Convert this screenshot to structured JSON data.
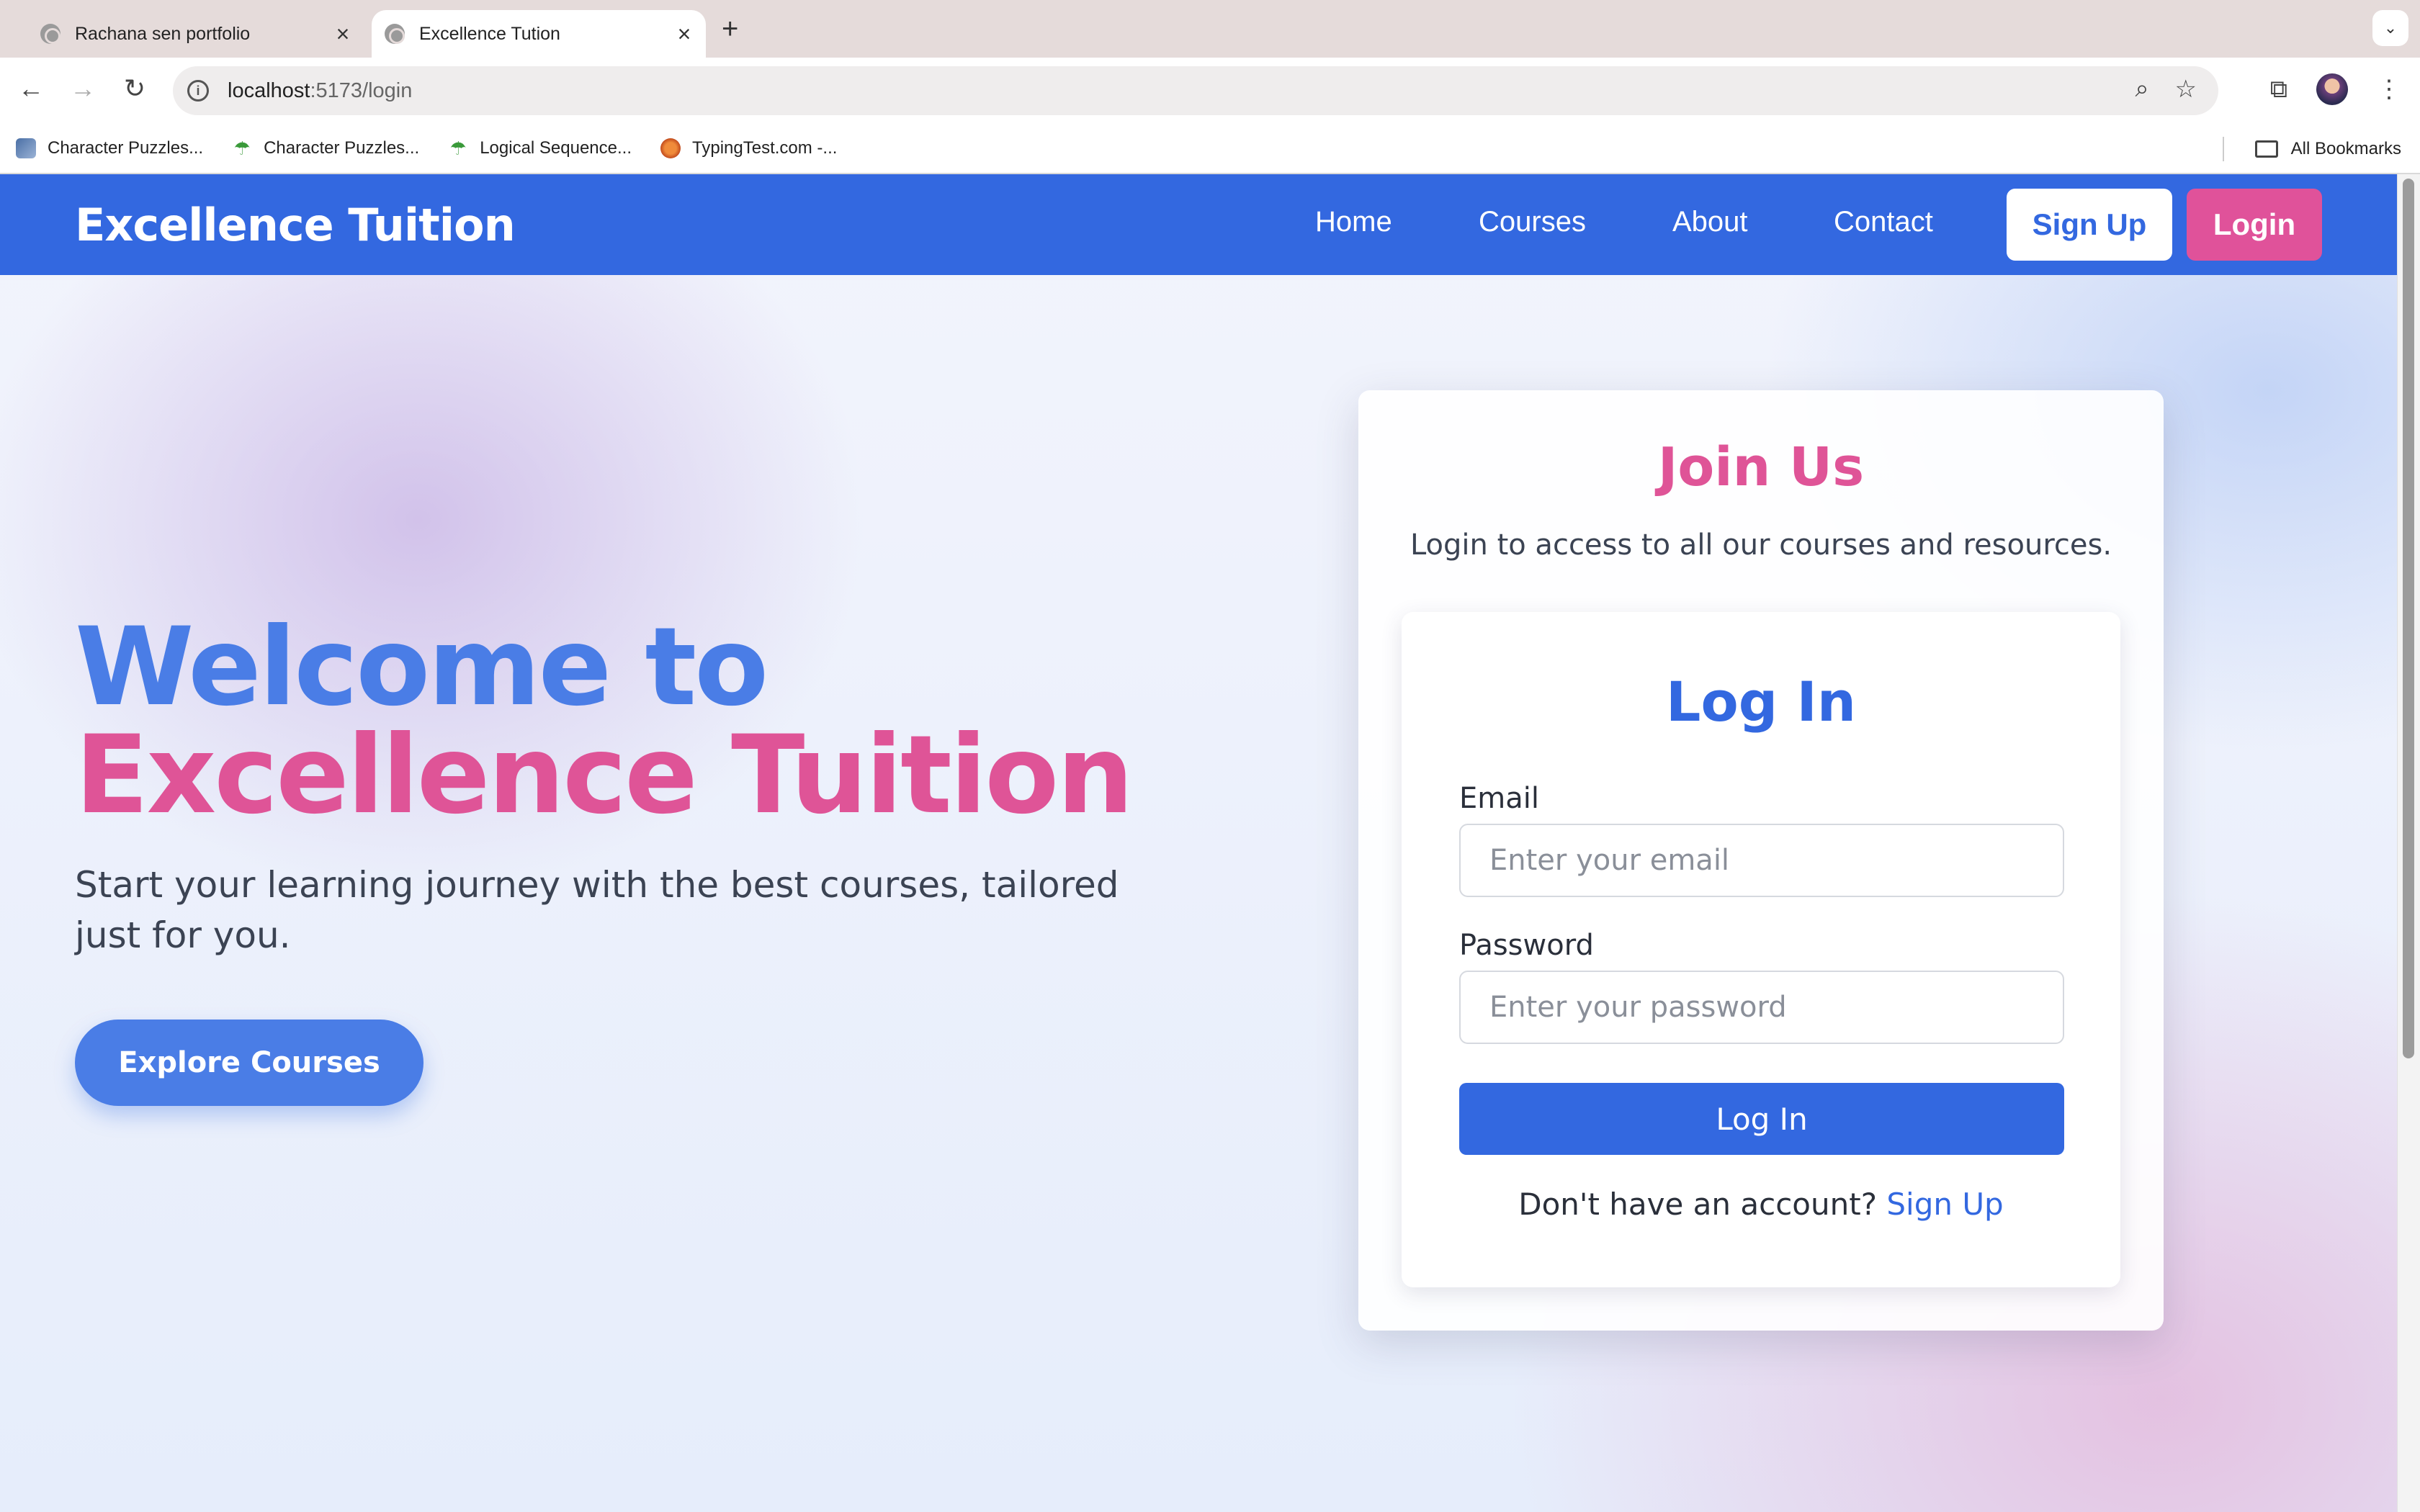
{
  "browser": {
    "tabs": [
      {
        "title": "Rachana sen portfolio",
        "active": false
      },
      {
        "title": "Excellence Tution",
        "active": true
      }
    ],
    "new_tab": "+",
    "tab_menu": "⌄",
    "url_host": "localhost",
    "url_path": ":5173/login",
    "bookmarks": [
      {
        "label": "Character Puzzles..."
      },
      {
        "label": "Character Puzzles..."
      },
      {
        "label": "Logical Sequence..."
      },
      {
        "label": "TypingTest.com -..."
      }
    ],
    "all_bookmarks": "All Bookmarks"
  },
  "site": {
    "brand": "Excellence Tuition",
    "nav": [
      "Home",
      "Courses",
      "About",
      "Contact"
    ],
    "signup_button": "Sign Up",
    "login_button": "Login"
  },
  "hero": {
    "title_line1": "Welcome to",
    "title_line2": "Excellence Tuition",
    "subtitle": "Start your learning journey with the best courses, tailored just for you.",
    "cta": "Explore Courses"
  },
  "join": {
    "title": "Join Us",
    "subtitle": "Login to access to all our courses and resources."
  },
  "login_form": {
    "title": "Log In",
    "email_label": "Email",
    "email_placeholder": "Enter your email",
    "password_label": "Password",
    "password_placeholder": "Enter your password",
    "submit": "Log In",
    "signup_prompt": "Don't have an account?",
    "signup_link": "Sign Up"
  },
  "colors": {
    "primary": "#3368e0",
    "accent_pink": "#df5497",
    "hero_blue": "#4a7de6"
  }
}
